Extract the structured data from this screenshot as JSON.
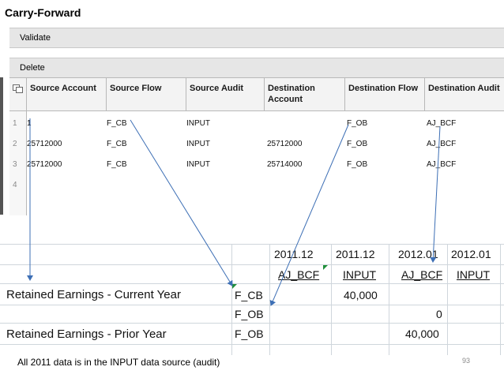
{
  "app": {
    "title": "Carry-Forward",
    "validate_label": "Validate",
    "delete_label": "Delete"
  },
  "grid": {
    "headers": [
      {
        "label": "Source Account"
      },
      {
        "label": "Source Flow"
      },
      {
        "label": "Source Audit"
      },
      {
        "label": "Destination Account"
      },
      {
        "label": "Destination Flow"
      },
      {
        "label": "Destination Audit"
      }
    ],
    "rows": [
      {
        "num": "1",
        "cells": [
          "1",
          "F_CB",
          "INPUT",
          "",
          "F_OB",
          "AJ_BCF"
        ]
      },
      {
        "num": "2",
        "cells": [
          "25712000",
          "F_CB",
          "INPUT",
          "25712000",
          "F_OB",
          "AJ_BCF"
        ]
      },
      {
        "num": "3",
        "cells": [
          "25712000",
          "F_CB",
          "INPUT",
          "25714000",
          "F_OB",
          "AJ_BCF"
        ]
      },
      {
        "num": "4",
        "cells": [
          "",
          "",
          "",
          "",
          "",
          ""
        ]
      }
    ]
  },
  "sheet": {
    "periods": [
      "2011.12",
      "2011.12",
      "2012.01",
      "2012.01"
    ],
    "audits": [
      "AJ_BCF",
      "INPUT",
      "AJ_BCF",
      "INPUT"
    ],
    "rows": [
      {
        "label": "Retained Earnings - Current Year",
        "flow": "F_CB",
        "values": [
          "",
          "40,000",
          "",
          ""
        ]
      },
      {
        "label": "",
        "flow": "F_OB",
        "values": [
          "",
          "",
          "0",
          ""
        ]
      },
      {
        "label": "Retained Earnings - Prior Year",
        "flow": "F_OB",
        "values": [
          "",
          "",
          "40,000",
          ""
        ]
      }
    ]
  },
  "footer": {
    "note": "All 2011 data is in the INPUT data source (audit)",
    "page_number": "93"
  },
  "colors": {
    "arrow": "#3d6fb5",
    "comment_marker": "#1f8f3a",
    "toolbar_bg": "#e6e6e6"
  }
}
